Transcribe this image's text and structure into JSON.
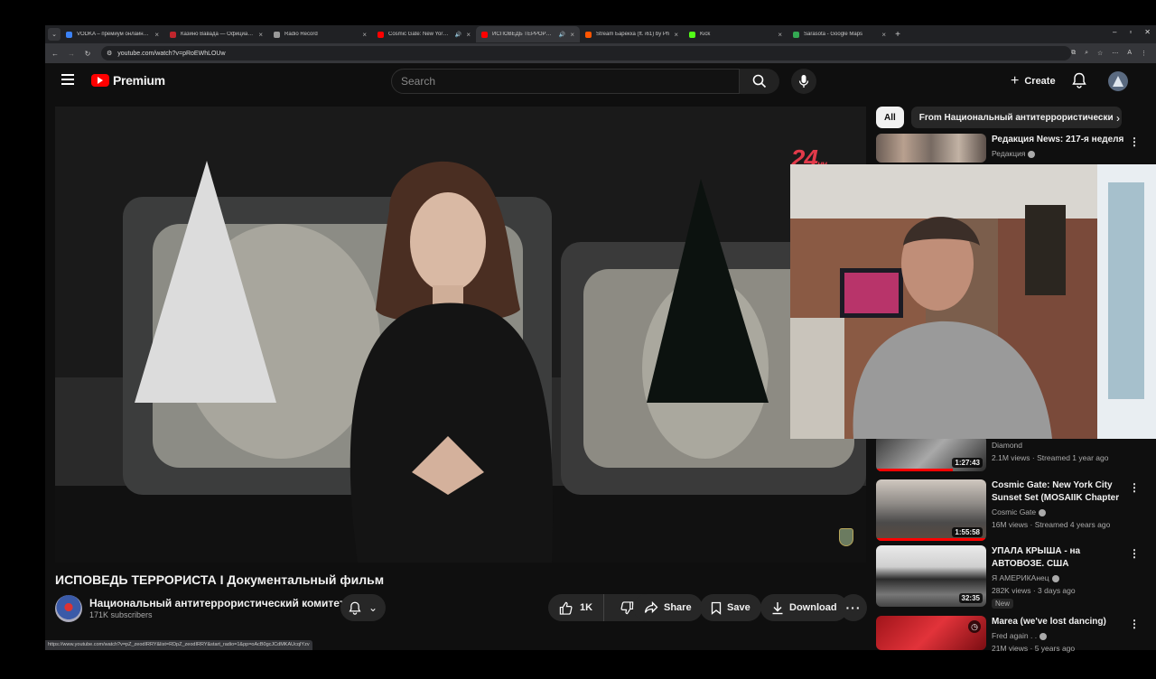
{
  "browser": {
    "tabs": [
      {
        "title": "VODKA – премиум онлайн-ка",
        "favicon_color": "#3b82f6"
      },
      {
        "title": "Казино Вавада — Официальн",
        "favicon_color": "#c0262d"
      },
      {
        "title": "Radio Record",
        "favicon_color": "#999999"
      },
      {
        "title": "Cosmic Gate: New York Ci",
        "favicon_color": "#ff0000",
        "audio": "🔊"
      },
      {
        "title": "ИСПОВЕДЬ ТЕРРОРИСТА",
        "favicon_color": "#ff0000",
        "audio": "🔊",
        "active": true
      },
      {
        "title": "Stream Барекха (ft. i61) by Ph",
        "favicon_color": "#ff5500"
      },
      {
        "title": "Kick",
        "favicon_color": "#53fc18"
      },
      {
        "title": "Sarasota - Google Maps",
        "favicon_color": "#34a853"
      }
    ],
    "url": "youtube.com/watch?v=pRoEWhLOUw",
    "status_url": "https://www.youtube.com/watch?v=pZ_zeodIRRY&list=RDpZ_zeodIRRY&start_radio=1&pp=oAcB0gcJCdMKAUcqIYzv"
  },
  "header": {
    "logo_text": "Premium",
    "search_placeholder": "Search",
    "create_label": "Create"
  },
  "player": {
    "watermark": "24",
    "watermark_sub": "нн"
  },
  "video": {
    "title": "ИСПОВЕДЬ ТЕРРОРИСТА I Документальный фильм",
    "channel": "Национальный антитеррористический комитет",
    "subscribers": "171K subscribers",
    "likes": "1K",
    "share_label": "Share",
    "save_label": "Save",
    "download_label": "Download"
  },
  "sidebar": {
    "chips": [
      "All",
      "From Национальный антитеррористически"
    ],
    "items": [
      {
        "title": "Редакция News: 217-я неделя",
        "channel": "Редакция",
        "meta": ""
      },
      {
        "title": "",
        "channel": "Diamond",
        "meta": "2.1M views · Streamed 1 year ago",
        "duration": "1:27:43"
      },
      {
        "title": "Cosmic Gate: New York City Sunset Set (MOSAIIK Chapter ...",
        "channel": "Cosmic Gate",
        "meta": "16M views · Streamed 4 years ago",
        "duration": "1:55:58"
      },
      {
        "title": "УПАЛА КРЫША - на АВТОВОЗЕ. США",
        "channel": "Я АМЕРИКАнец",
        "meta": "282K views · 3 days ago",
        "duration": "32:35",
        "badge": "New"
      },
      {
        "title": "Marea (we've lost dancing)",
        "channel": "Fred again . .",
        "meta": "21M views · 5 years ago"
      }
    ]
  },
  "colors": {
    "accent": "#ff0000",
    "background": "#0f0f0f",
    "surface": "#272727"
  }
}
